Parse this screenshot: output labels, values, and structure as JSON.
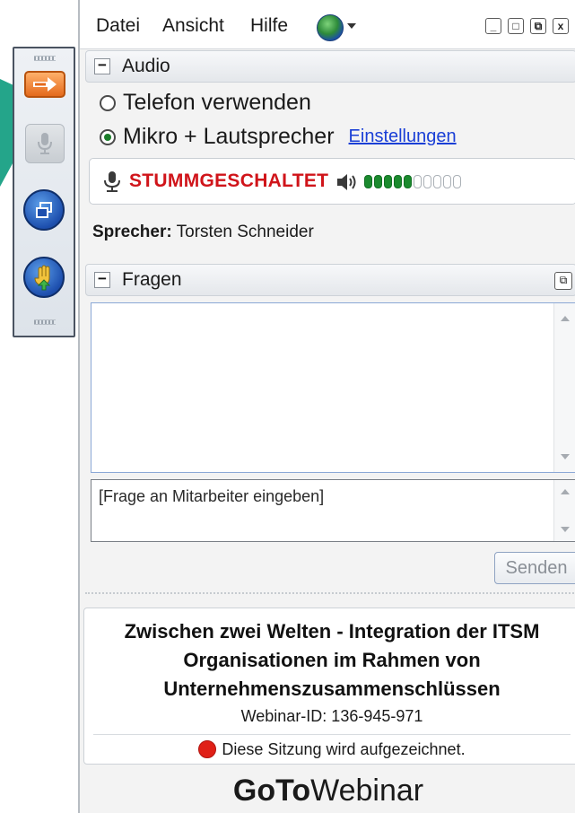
{
  "menu": {
    "items": [
      "Datei",
      "Ansicht",
      "Hilfe"
    ]
  },
  "window_controls": {
    "minimize": "_",
    "maximize": "□",
    "restore": "⧉",
    "close": "x"
  },
  "audio": {
    "section_title": "Audio",
    "option_phone": "Telefon verwenden",
    "option_mic": "Mikro + Lautsprecher",
    "selected": "Mikro + Lautsprecher",
    "settings_link": "Einstellungen",
    "mute_status": "STUMMGESCHALTET",
    "level_active": 5,
    "level_total": 10
  },
  "speaker": {
    "label": "Sprecher:",
    "name": "Torsten Schneider"
  },
  "questions": {
    "section_title": "Fragen",
    "input_placeholder": "[Frage an Mitarbeiter eingeben]",
    "send_label": "Senden"
  },
  "webinar": {
    "title_line1": "Zwischen zwei Welten - Integration der ITSM",
    "title_line2": "Organisationen im Rahmen von",
    "title_line3": "Unternehmenszusammenschlüssen",
    "webinar_id": "Webinar-ID: 136-945-971",
    "recording_notice": "Diese Sitzung wird aufgezeichnet."
  },
  "brand": {
    "bold": "GoTo",
    "regular": "Webinar"
  },
  "colors": {
    "mute_red": "#d0141a",
    "level_green": "#1b8a2e",
    "link_blue": "#1a3fd6",
    "accent_teal": "#24a58a",
    "grab_orange": "#e46a1c"
  }
}
